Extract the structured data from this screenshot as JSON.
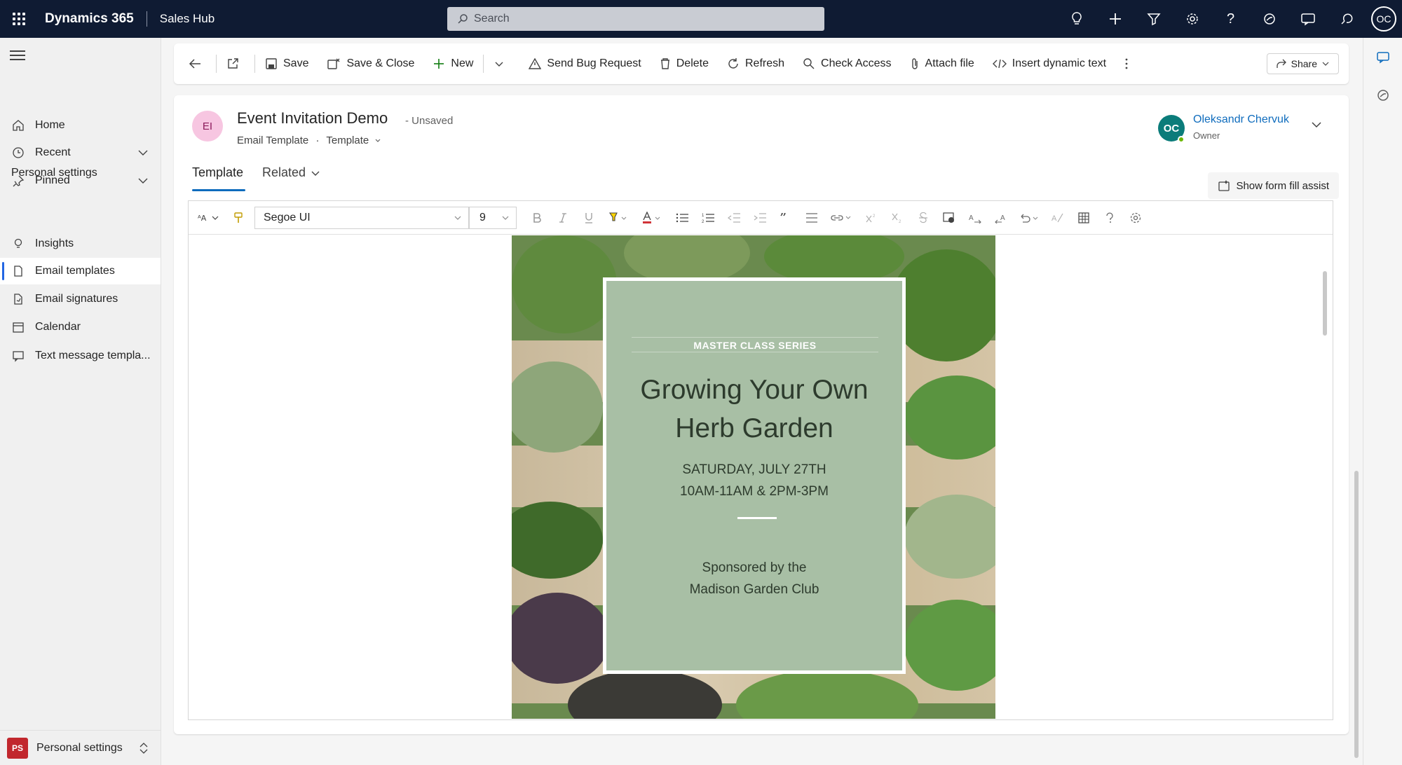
{
  "topbar": {
    "app_name": "Dynamics 365",
    "area_name": "Sales Hub",
    "search_placeholder": "Search",
    "user_initials": "OC"
  },
  "leftnav": {
    "items": [
      {
        "label": "Home",
        "icon": "home-icon"
      },
      {
        "label": "Recent",
        "icon": "clock-icon"
      },
      {
        "label": "Pinned",
        "icon": "pin-icon"
      }
    ],
    "section_title": "Personal settings",
    "section_items": [
      {
        "label": "Insights",
        "icon": "lightbulb-icon"
      },
      {
        "label": "Email templates",
        "icon": "document-icon",
        "active": true
      },
      {
        "label": "Email signatures",
        "icon": "signature-icon"
      },
      {
        "label": "Calendar",
        "icon": "calendar-icon"
      },
      {
        "label": "Text message templa...",
        "icon": "chat-icon"
      }
    ],
    "bottom": {
      "badge": "PS",
      "label": "Personal settings"
    }
  },
  "commandbar": {
    "save": "Save",
    "save_close": "Save & Close",
    "new": "New",
    "send_bug": "Send Bug Request",
    "delete": "Delete",
    "refresh": "Refresh",
    "check_access": "Check Access",
    "attach_file": "Attach file",
    "insert_dynamic": "Insert dynamic text",
    "share": "Share"
  },
  "record": {
    "initials": "EI",
    "title": "Event Invitation Demo",
    "status": "- Unsaved",
    "entity": "Email Template",
    "form": "Template",
    "owner_initials": "OC",
    "owner_name": "Oleksandr Chervuk",
    "owner_role": "Owner"
  },
  "tabs": {
    "template": "Template",
    "related": "Related"
  },
  "form_fill": "Show form fill assist",
  "editor": {
    "font": "Segoe UI",
    "size": "9"
  },
  "invitation": {
    "series": "MASTER CLASS SERIES",
    "title_line1": "Growing Your Own",
    "title_line2": "Herb Garden",
    "date": "SATURDAY, JULY 27TH",
    "time": "10AM-11AM & 2PM-3PM",
    "sponsor_line1": "Sponsored by the",
    "sponsor_line2": "Madison Garden Club"
  },
  "colors": {
    "topbar": "#0f1b33",
    "accent": "#0f6cbd",
    "card": "#a8bfa5",
    "record_avatar": "#f7c6e1",
    "owner_avatar": "#0b7c7a"
  }
}
